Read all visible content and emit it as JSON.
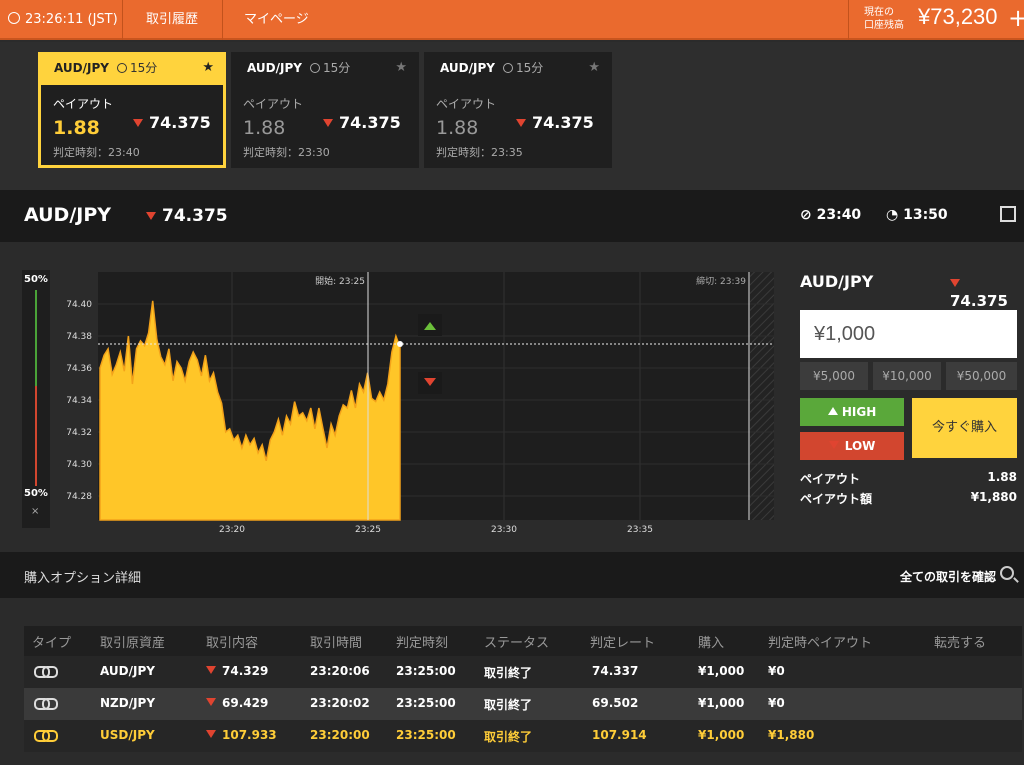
{
  "topbar": {
    "time": "23:26:11 (JST)",
    "history": "取引履歴",
    "mypage": "マイページ",
    "balance_label_1": "現在の",
    "balance_label_2": "口座残高",
    "balance": "¥73,230"
  },
  "cards": [
    {
      "pair": "AUD/JPY",
      "duration": "15分",
      "payout_label": "ペイアウト",
      "payout": "1.88",
      "rate": "74.375",
      "judge": "判定時刻：23:40"
    },
    {
      "pair": "AUD/JPY",
      "duration": "15分",
      "payout_label": "ペイアウト",
      "payout": "1.88",
      "rate": "74.375",
      "judge": "判定時刻：23:30"
    },
    {
      "pair": "AUD/JPY",
      "duration": "15分",
      "payout_label": "ペイアウト",
      "payout": "1.88",
      "rate": "74.375",
      "judge": "判定時刻：23:35"
    }
  ],
  "instrument": {
    "pair": "AUD/JPY",
    "rate": "74.375",
    "expiry": "23:40",
    "remaining": "13:50"
  },
  "gauge": {
    "top": "50%",
    "bottom": "50%",
    "close": "×"
  },
  "chart_data": {
    "type": "area",
    "start_label": "開始: 23:25",
    "end_label": "締切: 23:39",
    "yticks": [
      "74.40",
      "74.38",
      "74.36",
      "74.34",
      "74.32",
      "74.30",
      "74.28"
    ],
    "ytick_values": [
      74.4,
      74.38,
      74.36,
      74.34,
      74.32,
      74.3,
      74.28
    ],
    "xticks": [
      "23:20",
      "23:25",
      "23:30",
      "23:35"
    ],
    "ylim": [
      74.265,
      74.42
    ],
    "current_rate": 74.375,
    "series": [
      {
        "values": [
          74.36,
          74.368,
          74.372,
          74.356,
          74.362,
          74.37,
          74.358,
          74.38,
          74.35,
          74.372,
          74.377,
          74.374,
          74.382,
          74.402,
          74.378,
          74.367,
          74.362,
          74.372,
          74.352,
          74.364,
          74.36,
          74.352,
          74.364,
          74.37,
          74.365,
          74.355,
          74.368,
          74.352,
          74.357,
          74.345,
          74.338,
          74.32,
          74.322,
          74.315,
          74.318,
          74.31,
          74.318,
          74.312,
          74.316,
          74.307,
          74.312,
          74.302,
          74.315,
          74.32,
          74.328,
          74.318,
          74.33,
          74.325,
          74.339,
          74.33,
          74.332,
          74.327,
          74.335,
          74.322,
          74.335,
          74.322,
          74.31,
          74.325,
          74.318,
          74.33,
          74.337,
          74.335,
          74.346,
          74.335,
          74.35,
          74.345,
          74.357,
          74.341,
          74.339,
          74.345,
          74.34,
          74.35,
          74.37,
          74.38,
          74.373
        ]
      }
    ]
  },
  "panel": {
    "pair": "AUD/JPY",
    "rate": "74.375",
    "amount": "¥1,000",
    "quick": [
      "¥5,000",
      "¥10,000",
      "¥50,000"
    ],
    "high": "HIGH",
    "low": "LOW",
    "buy": "今すぐ購入",
    "payout_label": "ペイアウト",
    "payout": "1.88",
    "payout_amount_label": "ペイアウト額",
    "payout_amount": "¥1,880"
  },
  "options": {
    "title": "購入オプション詳細",
    "view_all": "全ての取引を確認"
  },
  "table": {
    "headers": [
      "タイプ",
      "取引原資産",
      "取引内容",
      "取引時間",
      "判定時刻",
      "ステータス",
      "判定レート",
      "購入",
      "判定時ペイアウト",
      "転売する"
    ],
    "rows": [
      {
        "asset": "AUD/JPY",
        "rate": "74.329",
        "time": "23:20:06",
        "judge": "23:25:00",
        "status": "取引終了",
        "judge_rate": "74.337",
        "amount": "¥1,000",
        "payout": "¥0"
      },
      {
        "asset": "NZD/JPY",
        "rate": "69.429",
        "time": "23:20:02",
        "judge": "23:25:00",
        "status": "取引終了",
        "judge_rate": "69.502",
        "amount": "¥1,000",
        "payout": "¥0"
      },
      {
        "asset": "USD/JPY",
        "rate": "107.933",
        "time": "23:20:00",
        "judge": "23:25:00",
        "status": "取引終了",
        "judge_rate": "107.914",
        "amount": "¥1,000",
        "payout": "¥1,880"
      }
    ]
  },
  "colors": {
    "accent": "#ea6a2e",
    "yellow": "#ffd33d",
    "up": "#5aa83a",
    "down": "#d2462f"
  }
}
